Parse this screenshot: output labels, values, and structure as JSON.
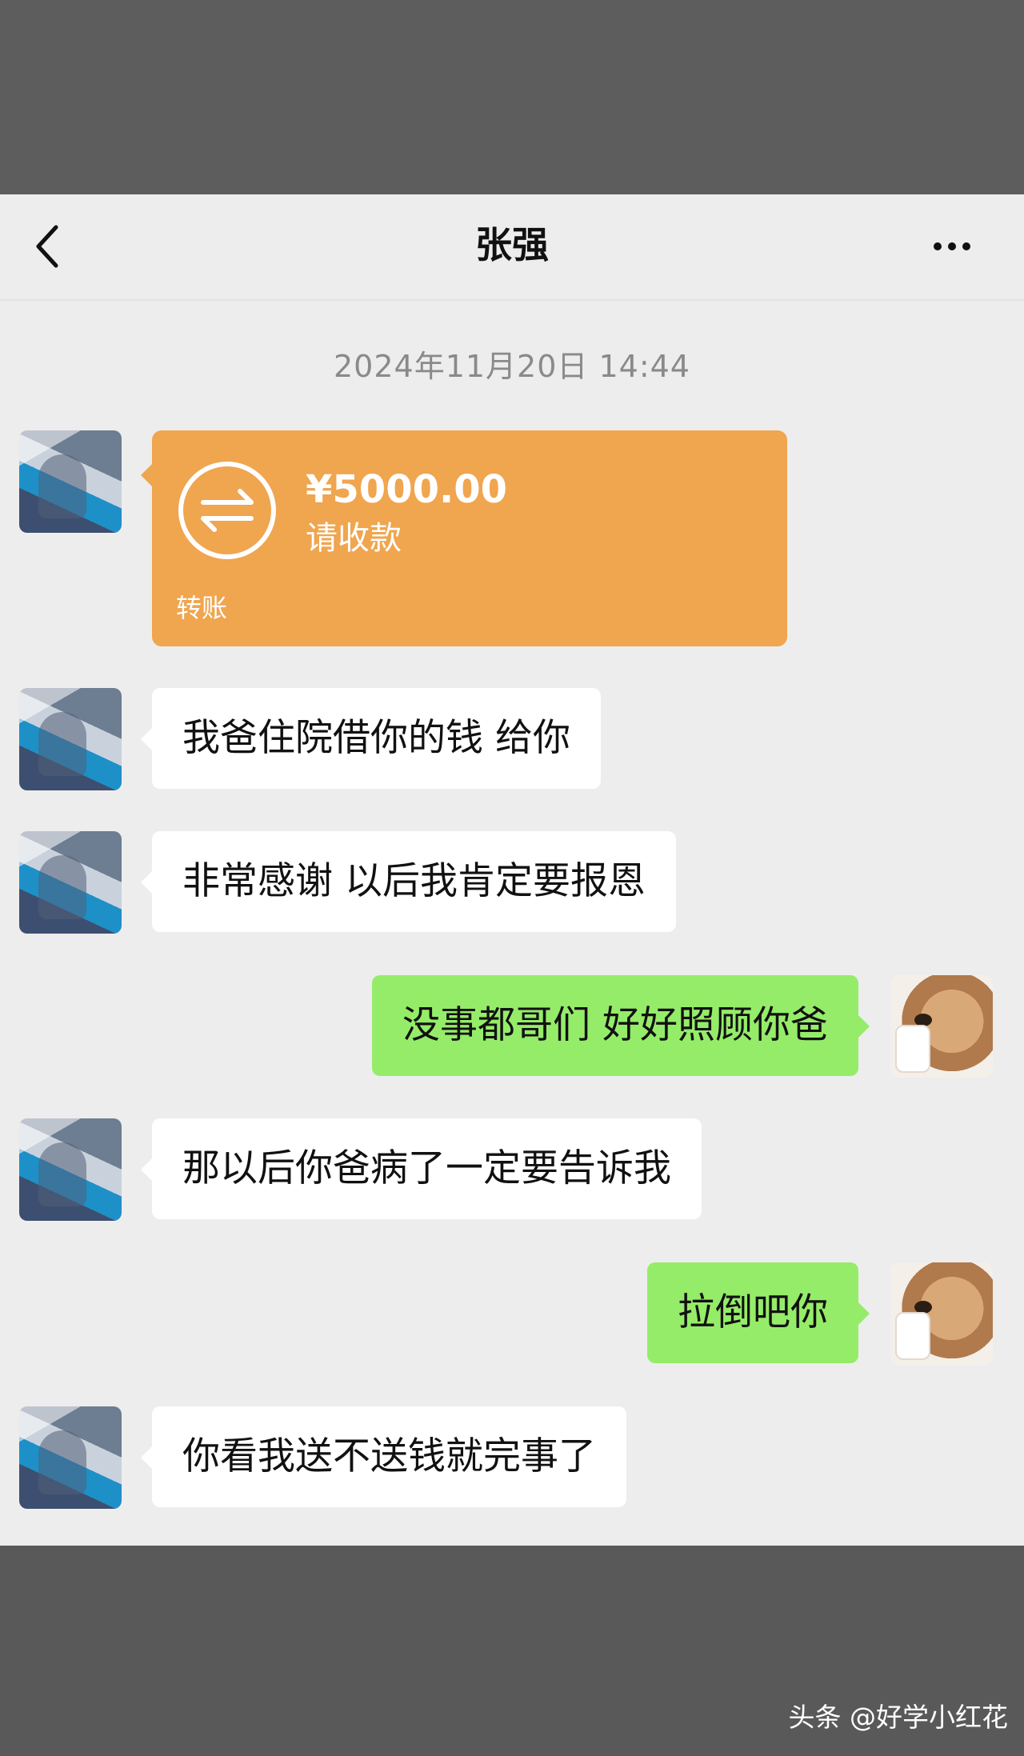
{
  "nav": {
    "title": "张强",
    "back_icon": "chevron-left-icon",
    "more_icon": "ellipsis-icon"
  },
  "chat": {
    "timestamp": "2024年11月20日 14:44",
    "transfer": {
      "amount": "¥5000.00",
      "status": "请收款",
      "label": "转账",
      "icon": "transfer-arrows-icon",
      "color": "#f0a54f"
    },
    "messages": [
      {
        "side": "left",
        "text": "我爸住院借你的钱 给你"
      },
      {
        "side": "left",
        "text": "非常感谢 以后我肯定要报恩"
      },
      {
        "side": "right",
        "text": "没事都哥们 好好照顾你爸"
      },
      {
        "side": "left",
        "text": "那以后你爸病了一定要告诉我"
      },
      {
        "side": "right",
        "text": "拉倒吧你"
      },
      {
        "side": "left",
        "text": "你看我送不送钱就完事了"
      }
    ]
  },
  "colors": {
    "sent_bubble": "#95ec69",
    "received_bubble": "#ffffff",
    "background": "#ededed"
  },
  "watermark": "头条 @好学小红花"
}
